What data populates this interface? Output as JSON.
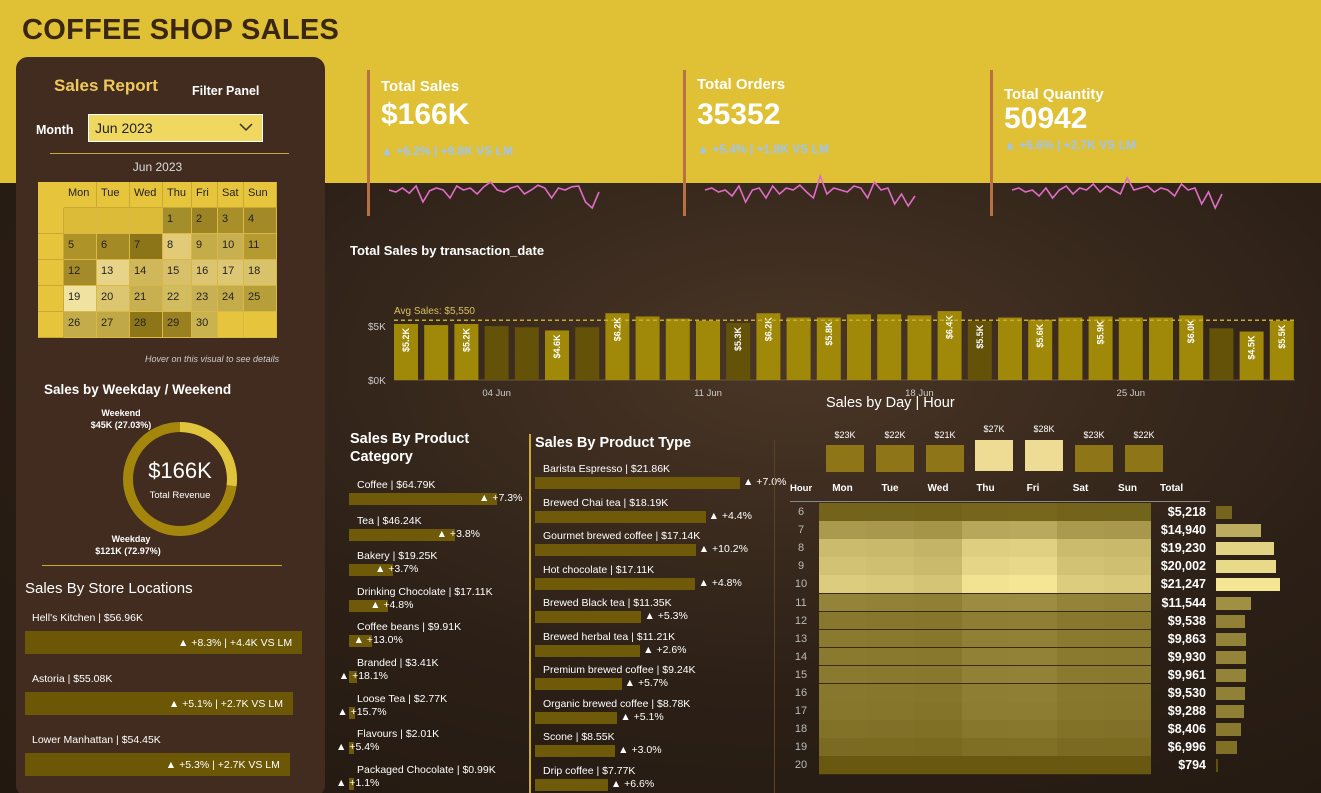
{
  "title": "COFFEE SHOP SALES",
  "filter": {
    "report_title": "Sales Report",
    "panel_title": "Filter Panel",
    "month_label": "Month",
    "month_value": "Jun 2023",
    "hint": "Hover on this visual to see details"
  },
  "calendar": {
    "title": "Jun 2023",
    "weekdays": [
      "Mon",
      "Tue",
      "Wed",
      "Thu",
      "Fri",
      "Sat",
      "Sun"
    ],
    "weeks": [
      [
        {
          "d": "",
          "c": "#dcbb38"
        },
        {
          "d": "",
          "c": "#dcbb38"
        },
        {
          "d": "",
          "c": "#dcbb38"
        },
        {
          "d": "1",
          "c": "#a48e2a"
        },
        {
          "d": "2",
          "c": "#9c8424"
        },
        {
          "d": "3",
          "c": "#a98f2a"
        },
        {
          "d": "4",
          "c": "#a48a26"
        }
      ],
      [
        {
          "d": "5",
          "c": "#ae9428"
        },
        {
          "d": "6",
          "c": "#a48a24"
        },
        {
          "d": "7",
          "c": "#8c7418"
        },
        {
          "d": "8",
          "c": "#e2ca78"
        },
        {
          "d": "9",
          "c": "#c4ac48"
        },
        {
          "d": "10",
          "c": "#c8b050"
        },
        {
          "d": "11",
          "c": "#b49a30"
        }
      ],
      [
        {
          "d": "12",
          "c": "#a48a28"
        },
        {
          "d": "13",
          "c": "#e8d488"
        },
        {
          "d": "14",
          "c": "#d0b85a"
        },
        {
          "d": "15",
          "c": "#d8c06a"
        },
        {
          "d": "16",
          "c": "#dcc470"
        },
        {
          "d": "17",
          "c": "#ddc674"
        },
        {
          "d": "18",
          "c": "#d8c26a"
        }
      ],
      [
        {
          "d": "19",
          "c": "#f0e2a0"
        },
        {
          "d": "20",
          "c": "#dcc670"
        },
        {
          "d": "21",
          "c": "#c8b050"
        },
        {
          "d": "22",
          "c": "#d2bc60"
        },
        {
          "d": "23",
          "c": "#c8b054"
        },
        {
          "d": "24",
          "c": "#c4ac4a"
        },
        {
          "d": "25",
          "c": "#b69e38"
        }
      ],
      [
        {
          "d": "26",
          "c": "#c4ac4a"
        },
        {
          "d": "27",
          "c": "#c0a846"
        },
        {
          "d": "28",
          "c": "#8e7618"
        },
        {
          "d": "29",
          "c": "#9a8020"
        },
        {
          "d": "30",
          "c": "#cab24e"
        },
        {
          "d": "",
          "c": "#e6c43c"
        },
        {
          "d": "",
          "c": "#e6c43c"
        }
      ]
    ]
  },
  "kpis": [
    {
      "label": "Total Sales",
      "value": "$166K",
      "change": "▲ +6.2% | +9.8K VS LM",
      "spark": [
        0.5,
        0.45,
        0.55,
        0.42,
        0.6,
        0.2,
        0.48,
        0.55,
        0.5,
        0.3,
        0.6,
        0.5,
        0.55,
        0.4,
        0.58,
        0.7,
        0.5,
        0.45,
        0.55,
        0.6,
        0.4,
        0.5,
        0.62,
        0.55,
        0.3,
        0.55,
        0.5,
        0.58,
        0.6,
        0.2,
        0.05,
        0.45
      ]
    },
    {
      "label": "Total Orders",
      "value": "35352",
      "change": "▲ +5.4% | +1.8K VS LM",
      "spark": [
        0.5,
        0.55,
        0.45,
        0.5,
        0.35,
        0.6,
        0.2,
        0.5,
        0.55,
        0.3,
        0.6,
        0.4,
        0.55,
        0.5,
        0.62,
        0.45,
        0.3,
        0.85,
        0.4,
        0.55,
        0.5,
        0.45,
        0.6,
        0.55,
        0.3,
        0.7,
        0.5,
        0.55,
        0.15,
        0.4,
        0.1,
        0.35
      ]
    },
    {
      "label": "Total Quantity",
      "value": "50942",
      "change": "▲ +5.6% | +2.7K VS LM",
      "spark": [
        0.5,
        0.55,
        0.45,
        0.5,
        0.35,
        0.55,
        0.3,
        0.5,
        0.6,
        0.4,
        0.55,
        0.5,
        0.65,
        0.45,
        0.6,
        0.5,
        0.4,
        0.8,
        0.5,
        0.55,
        0.6,
        0.45,
        0.55,
        0.5,
        0.35,
        0.65,
        0.5,
        0.55,
        0.15,
        0.45,
        0.05,
        0.4
      ]
    }
  ],
  "weekday": {
    "title": "Sales by Weekday / Weekend",
    "center_value": "$166K",
    "center_label": "Total Revenue",
    "weekend_label": "Weekend",
    "weekend_value": "$45K (27.03%)",
    "weekend_share": 0.2703,
    "weekday_label": "Weekday",
    "weekday_value": "$121K (72.97%)"
  },
  "stores": {
    "title": "Sales By Store Locations",
    "items": [
      {
        "label": "Hell's Kitchen | $56.96K",
        "value": 56.96,
        "change": "▲ +8.3% | +4.4K VS LM"
      },
      {
        "label": "Astoria | $55.08K",
        "value": 55.08,
        "change": "▲ +5.1% | +2.7K VS LM"
      },
      {
        "label": "Lower Manhattan | $54.45K",
        "value": 54.45,
        "change": "▲ +5.3% | +2.7K VS LM"
      }
    ]
  },
  "category": {
    "title_line1": "Sales By Product",
    "title_line2": "Category",
    "items": [
      {
        "label": "Coffee | $64.79K",
        "value": 64.79,
        "change": "▲ +7.3%"
      },
      {
        "label": "Tea | $46.24K",
        "value": 46.24,
        "change": "▲ +3.8%"
      },
      {
        "label": "Bakery | $19.25K",
        "value": 19.25,
        "change": "▲ +3.7%"
      },
      {
        "label": "Drinking Chocolate | $17.11K",
        "value": 17.11,
        "change": "▲ +4.8%"
      },
      {
        "label": "Coffee beans | $9.91K",
        "value": 9.91,
        "change": "▲ +13.0%"
      },
      {
        "label": "Branded | $3.41K",
        "value": 3.41,
        "change": "▲ +18.1%"
      },
      {
        "label": "Loose Tea | $2.77K",
        "value": 2.77,
        "change": "▲ +15.7%"
      },
      {
        "label": "Flavours | $2.01K",
        "value": 2.01,
        "change": "▲ +5.4%"
      },
      {
        "label": "Packaged Chocolate | $0.99K",
        "value": 0.99,
        "change": "▲ +1.1%"
      }
    ]
  },
  "ptype": {
    "title": "Sales By Product Type",
    "items": [
      {
        "label": "Barista Espresso | $21.86K",
        "value": 21.86,
        "change": "▲ +7.0%"
      },
      {
        "label": "Brewed Chai tea | $18.19K",
        "value": 18.19,
        "change": "▲ +4.4%"
      },
      {
        "label": "Gourmet brewed coffee | $17.14K",
        "value": 17.14,
        "change": "▲ +10.2%"
      },
      {
        "label": "Hot chocolate | $17.11K",
        "value": 17.11,
        "change": "▲ +4.8%"
      },
      {
        "label": "Brewed Black tea | $11.35K",
        "value": 11.35,
        "change": "▲ +5.3%"
      },
      {
        "label": "Brewed herbal tea | $11.21K",
        "value": 11.21,
        "change": "▲ +2.6%"
      },
      {
        "label": "Premium brewed coffee | $9.24K",
        "value": 9.24,
        "change": "▲ +5.7%"
      },
      {
        "label": "Organic brewed coffee | $8.78K",
        "value": 8.78,
        "change": "▲ +5.1%"
      },
      {
        "label": "Scone | $8.55K",
        "value": 8.55,
        "change": "▲ +3.0%"
      },
      {
        "label": "Drip coffee | $7.77K",
        "value": 7.77,
        "change": "▲ +6.6%"
      }
    ]
  },
  "chart_data": {
    "type": "bar",
    "title": "Total Sales by transaction_date",
    "avg_label": "Avg Sales: $5,550",
    "avg": 5550,
    "y_ticks": [
      "$0K",
      "$5K"
    ],
    "ylim": [
      0,
      7000
    ],
    "x_ticks": [
      "04 Jun",
      "11 Jun",
      "18 Jun",
      "25 Jun"
    ],
    "values": [
      5200,
      5100,
      5200,
      5000,
      4900,
      4600,
      4900,
      6200,
      5900,
      5700,
      5500,
      5300,
      6200,
      5800,
      5800,
      6100,
      6100,
      6000,
      6400,
      5500,
      5800,
      5600,
      5800,
      5900,
      5800,
      5800,
      6000,
      4800,
      4500,
      5500
    ],
    "labels": [
      "$5.2K",
      "",
      "$5.2K",
      "",
      "",
      "$4.6K",
      "",
      "$6.2K",
      "",
      "",
      "",
      "$5.3K",
      "$6.2K",
      "",
      "$5.8K",
      "",
      "",
      "",
      "$6.4K",
      "$5.5K",
      "",
      "$5.6K",
      "",
      "$5.9K",
      "",
      "",
      "$6.0K",
      "",
      "$4.5K",
      "$5.5K"
    ]
  },
  "heatmap": {
    "title": "Sales by Day | Hour",
    "hour_header": "Hour",
    "total_header": "Total",
    "days": [
      "Mon",
      "Tue",
      "Wed",
      "Thu",
      "Fri",
      "Sat",
      "Sun"
    ],
    "day_totals": [
      "$23K",
      "$22K",
      "$21K",
      "$27K",
      "$28K",
      "$23K",
      "$22K"
    ],
    "day_values": [
      23,
      22,
      21,
      27,
      28,
      23,
      22
    ],
    "hours": [
      "6",
      "7",
      "8",
      "9",
      "10",
      "11",
      "12",
      "13",
      "14",
      "15",
      "16",
      "17",
      "18",
      "19",
      "20"
    ],
    "totals": [
      "$5,218",
      "$14,940",
      "$19,230",
      "$20,002",
      "$21,247",
      "$11,544",
      "$9,538",
      "$9,863",
      "$9,930",
      "$9,961",
      "$9,530",
      "$9,288",
      "$8,406",
      "$6,996",
      "$794"
    ],
    "total_values": [
      5218,
      14940,
      19230,
      20002,
      21247,
      11544,
      9538,
      9863,
      9930,
      9961,
      9530,
      9288,
      8406,
      6996,
      794
    ]
  }
}
